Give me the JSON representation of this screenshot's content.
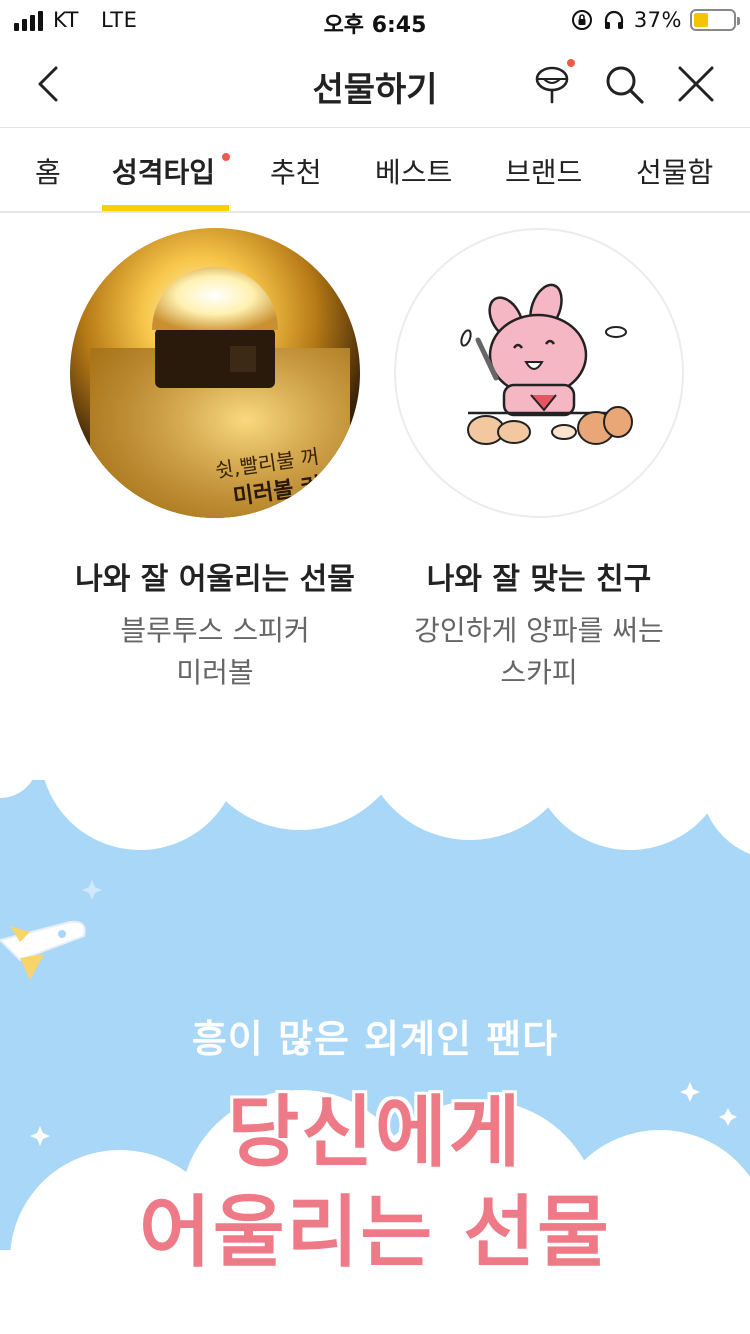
{
  "status_bar": {
    "carrier": "KT",
    "network": "LTE",
    "time": "오후 6:45",
    "battery_percent": "37%",
    "battery_level": 0.37
  },
  "nav": {
    "title": "선물하기"
  },
  "tabs": [
    {
      "label": "홈",
      "active": false
    },
    {
      "label": "성격타입",
      "active": true
    },
    {
      "label": "추천",
      "active": false
    },
    {
      "label": "베스트",
      "active": false
    },
    {
      "label": "브랜드",
      "active": false
    },
    {
      "label": "선물함",
      "active": false
    }
  ],
  "cards": [
    {
      "title": "나와 잘 어울리는 선물",
      "desc": "블루투스 스피커\n미러볼",
      "image_text_1": "쉿,빨리불 꺼",
      "image_text_2": "미러볼 켜"
    },
    {
      "title": "나와 잘 맞는 친구",
      "desc": "강인하게 양파를 써는\n스카피"
    }
  ],
  "banner": {
    "subtitle": "흥이 많은 외계인 팬다",
    "title_line1": "당신에게",
    "title_line2": "어울리는 선물"
  },
  "colors": {
    "accent_yellow": "#fad000",
    "notification_red": "#f05a4a",
    "banner_sky": "#a9d7f7",
    "banner_pink": "#ee7a87"
  }
}
